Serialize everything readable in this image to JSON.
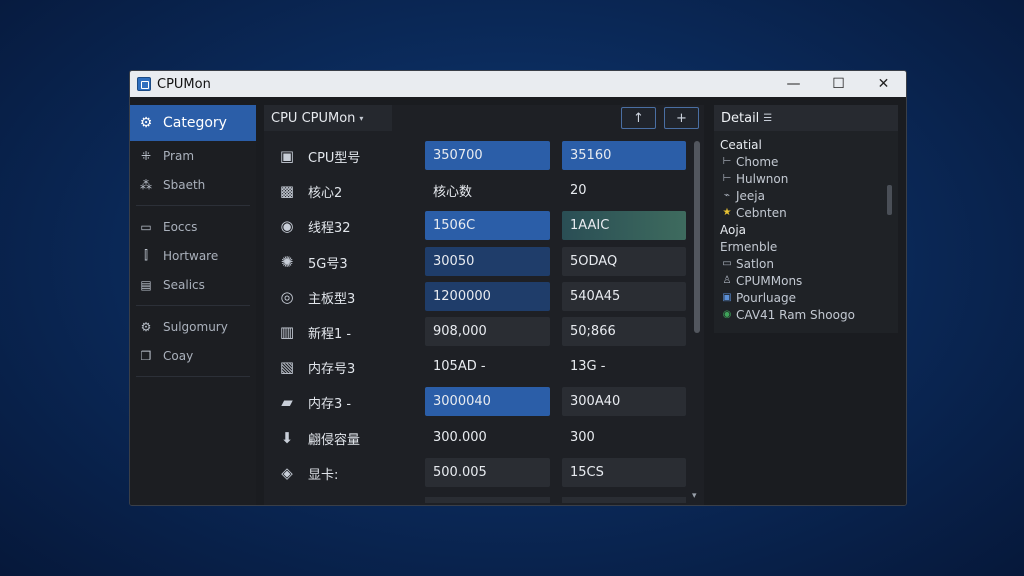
{
  "window": {
    "title": "CPUMon",
    "minimize": "—",
    "maximize": "☐",
    "close": "✕"
  },
  "sidebar": {
    "items": [
      {
        "label": "Category",
        "icon": "gear-icon",
        "glyph": "⚙"
      },
      {
        "label": "Pram",
        "icon": "grid-icon",
        "glyph": "⁜"
      },
      {
        "label": "Sbaeth",
        "icon": "cluster-icon",
        "glyph": "⁂"
      },
      {
        "label": "Eoccs",
        "icon": "box-icon",
        "glyph": "▭"
      },
      {
        "label": "Hortware",
        "icon": "chart-icon",
        "glyph": "⫿"
      },
      {
        "label": "Sealics",
        "icon": "window-icon",
        "glyph": "▤"
      },
      {
        "label": "Sulgomury",
        "icon": "cog-icon",
        "glyph": "⚙"
      },
      {
        "label": "Coay",
        "icon": "cube-icon",
        "glyph": "❒"
      }
    ]
  },
  "center": {
    "tab_label": "CPU CPUMon",
    "tab_caret": "▾",
    "up_button": "↑",
    "add_button": "+",
    "rows": [
      {
        "icon": "chip-icon",
        "glyph": "▣",
        "label": "CPU型号",
        "v1": "350700",
        "v2": "35160",
        "s1": "blue",
        "s2": "blue"
      },
      {
        "icon": "processor-icon",
        "glyph": "▩",
        "label": "核心2",
        "v1": "核心数",
        "v2": "20",
        "s1": "plain",
        "s2": "plain"
      },
      {
        "icon": "disc-icon",
        "glyph": "◉",
        "label": "线程32",
        "v1": "1506C",
        "v2": "1AAIC",
        "s1": "blue",
        "s2": "teal"
      },
      {
        "icon": "sync-icon",
        "glyph": "✺",
        "label": "5G号3",
        "v1": "30050",
        "v2": "5ODAQ",
        "s1": "blue2",
        "s2": "dark"
      },
      {
        "icon": "target-icon",
        "glyph": "◎",
        "label": "主板型3",
        "v1": "1200000",
        "v2": "540A45",
        "s1": "blue2",
        "s2": "dark"
      },
      {
        "icon": "board-icon",
        "glyph": "▥",
        "label": "新程1 -",
        "v1": "908,000",
        "v2": "50;866",
        "s1": "dark",
        "s2": "dark"
      },
      {
        "icon": "memory-icon",
        "glyph": "▧",
        "label": "内存号3",
        "v1": "105AD -",
        "v2": "13G -",
        "s1": "plain",
        "s2": "plain"
      },
      {
        "icon": "folder-icon",
        "glyph": "▰",
        "label": "内存3 -",
        "v1": "3000040",
        "v2": "300A40",
        "s1": "blue",
        "s2": "dark"
      },
      {
        "icon": "download-icon",
        "glyph": "⬇",
        "label": "翩侵容量",
        "v1": "300.000",
        "v2": "300",
        "s1": "plain",
        "s2": "plain"
      },
      {
        "icon": "eye-icon",
        "glyph": "◈",
        "label": "显卡:",
        "v1": "500.005",
        "v2": "15CS",
        "s1": "dark",
        "s2": "dark"
      }
    ]
  },
  "detail": {
    "title": "Detail",
    "items": [
      {
        "label": "Ceatial",
        "icon": "",
        "glyph": "",
        "head": true
      },
      {
        "label": "Chome",
        "icon": "tree-branch-icon",
        "glyph": "⊢"
      },
      {
        "label": "Hulwnon",
        "icon": "tree-branch-icon",
        "glyph": "⊢"
      },
      {
        "label": "Jeeja",
        "icon": "link-icon",
        "glyph": "⌁"
      },
      {
        "label": "Cebnten",
        "icon": "star-icon",
        "glyph": "★"
      },
      {
        "label": "Aoja",
        "icon": "",
        "glyph": "",
        "head": true
      },
      {
        "label": "Ermenble",
        "icon": "",
        "glyph": ""
      },
      {
        "label": "Satlon",
        "icon": "folder-icon",
        "glyph": "▭"
      },
      {
        "label": "CPUMMons",
        "icon": "user-icon",
        "glyph": "♙"
      },
      {
        "label": "Pourluage",
        "icon": "monitor-icon",
        "glyph": "▣"
      },
      {
        "label": "CAV41 Ram Shoogo",
        "icon": "chrome-icon",
        "glyph": "◉"
      }
    ]
  },
  "colors": {
    "accent": "#2b5ea8",
    "background": "#1a1c20",
    "desktop": "#0b2b5c"
  }
}
